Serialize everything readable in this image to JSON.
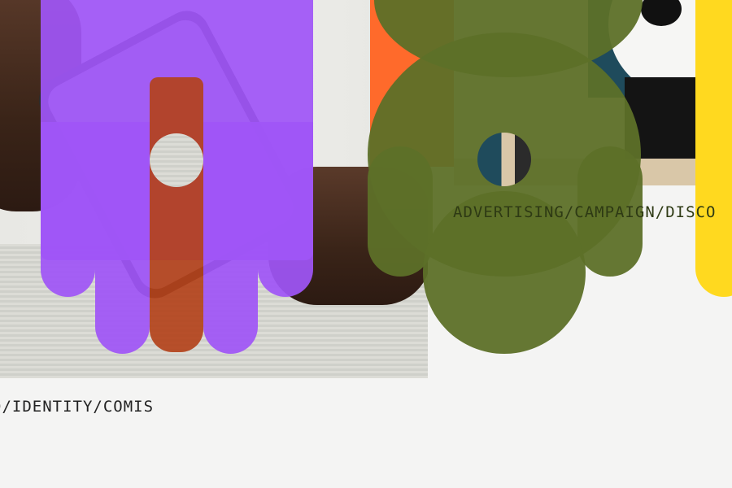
{
  "projects": [
    {
      "caption": "D/IDENTITY/COMIS"
    },
    {
      "caption": "ADVERTISING/CAMPAIGN/DISCO"
    }
  ],
  "colors": {
    "background": "#f4f4f3",
    "purple": "#9f55f6",
    "rust": "#b3421b",
    "orange": "#ff6a2b",
    "olive": "#5d7028",
    "yellow": "#ffd91f"
  }
}
